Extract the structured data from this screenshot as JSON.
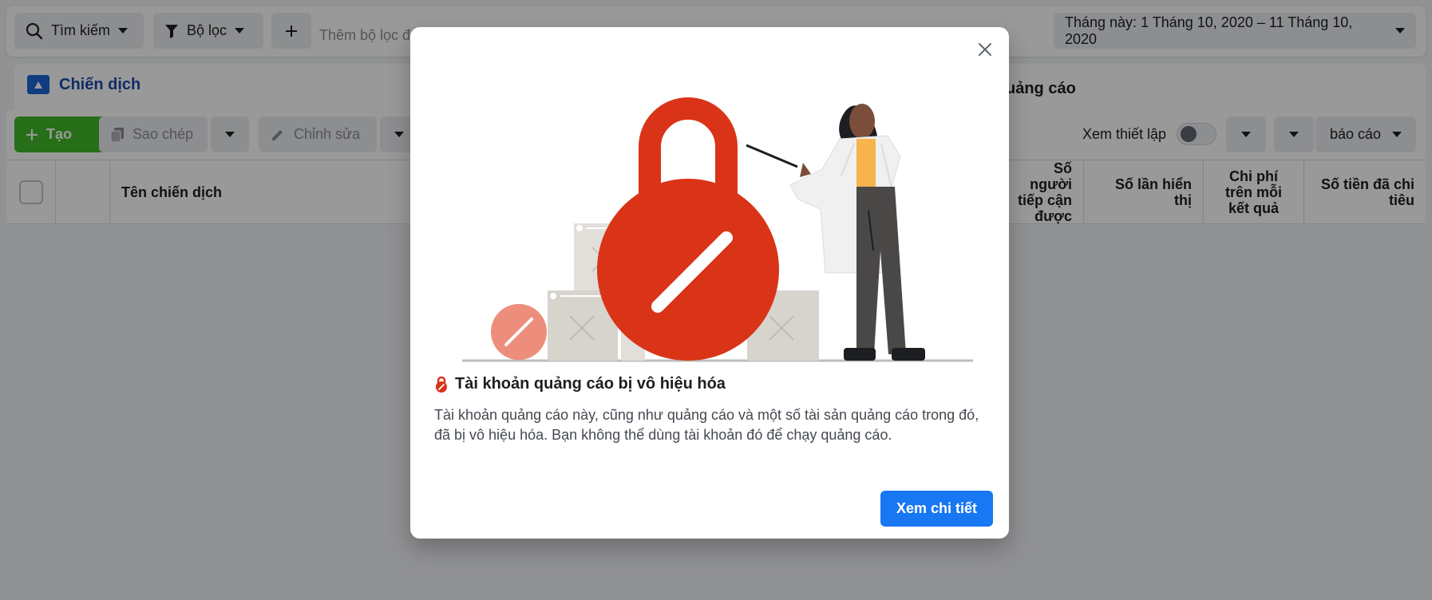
{
  "topbar": {
    "search_label": "Tìm kiếm",
    "filter_label": "Bộ lọc",
    "add_filter_placeholder": "Thêm bộ lọc để thu hẹp dữ liệu",
    "date_range": "Tháng này: 1 Tháng 10, 2020 – 11 Tháng 10, 2020"
  },
  "tabs": {
    "campaigns": "Chiến dịch",
    "ads_partial": "uảng cáo"
  },
  "toolbar": {
    "create": "Tạo",
    "duplicate": "Sao chép",
    "edit": "Chỉnh sửa",
    "view_setup": "Xem thiết lập",
    "reports": "báo cáo"
  },
  "table": {
    "columns": {
      "name": "Tên chiến dịch",
      "reach": "Số người tiếp cận được",
      "impressions": "Số lần hiển thị",
      "cost_per_result": "Chi phí trên mỗi kết quả",
      "amount_spent": "Số tiền đã chi tiêu"
    }
  },
  "modal": {
    "title": "Tài khoản quảng cáo bị vô hiệu hóa",
    "body": "Tài khoản quảng cáo này, cũng như quảng cáo và một số tài sản quảng cáo trong đó, đã bị vô hiệu hóa. Bạn không thể dùng tài khoản đó để chạy quảng cáo.",
    "action": "Xem chi tiết"
  },
  "colors": {
    "lock_red": "#d93418",
    "primary_blue": "#1877f2",
    "create_green": "#42b72a",
    "campaign_blue": "#1b4aa8"
  }
}
